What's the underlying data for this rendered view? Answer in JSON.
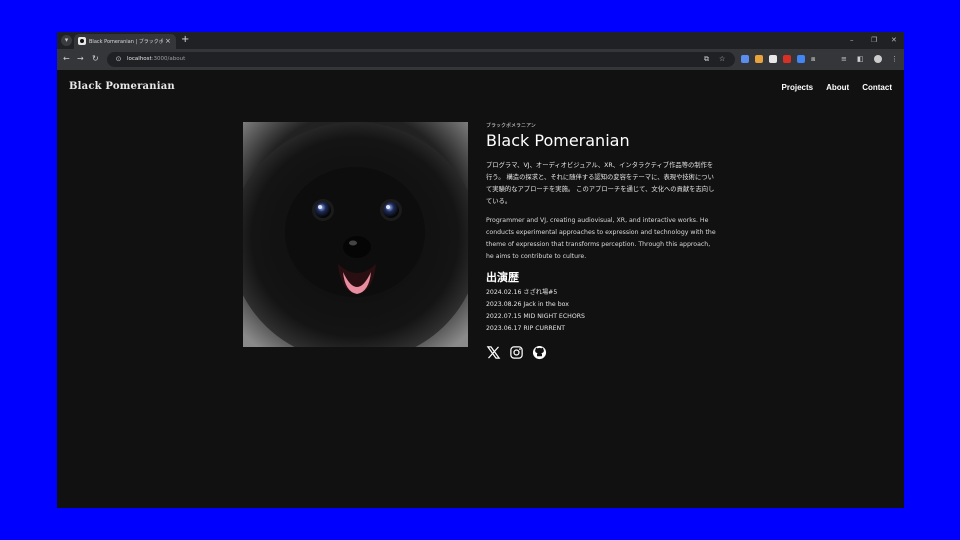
{
  "browser": {
    "tab_title": "Black Pomeranian | ブラックポメラ",
    "tab_close": "×",
    "new_tab": "+",
    "url_host": "localhost",
    "url_path": ":3000/about",
    "window_controls": {
      "minimize": "–",
      "restore": "❐",
      "close": "✕"
    }
  },
  "site": {
    "logo": "Black Pomeranian",
    "nav": {
      "projects": "Projects",
      "about": "About",
      "contact": "Contact"
    }
  },
  "profile": {
    "ruby": "ブラックポメラニアン",
    "name": "Black Pomeranian",
    "bio_ja": "プログラマ、VJ、オーディオビジュアル、XR、インタラクティブ作品等の制作を行う。 構造の探求と、それに随伴する認知の変容をテーマに、表現や技術について実験的なアプローチを実施。 このアプローチを通じて、文化への貢献を志向している。",
    "bio_en": "Programmer and VJ, creating audiovisual, XR, and interactive works. He conducts experimental approaches to expression and technology with the theme of expression that transforms perception. Through this approach, he aims to contribute to culture.",
    "career_title": "出演歴",
    "career": [
      "2024.02.16 さざれ場#5",
      "2023.08.26 Jack in the box",
      "2022.07.15 MID NIGHT ECHORS",
      "2023.06.17 RIP CURRENT"
    ]
  },
  "icons": {
    "social": [
      "x-icon",
      "instagram-icon",
      "github-icon"
    ]
  },
  "colors": {
    "background": "#0000ff",
    "page_bg": "#111111",
    "text": "#ffffff"
  }
}
